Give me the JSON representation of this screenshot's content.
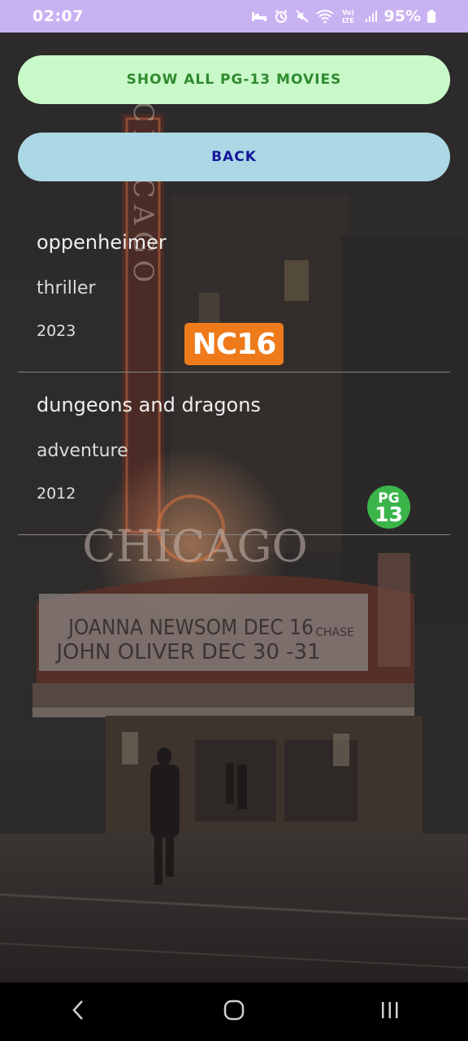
{
  "status_bar": {
    "time": "02:07",
    "battery": "95%",
    "icons": [
      "bed-icon",
      "alarm-icon",
      "mute-icon",
      "wifi-icon",
      "volte-icon",
      "signal-icon",
      "battery-icon"
    ],
    "volte_label": "Vo) LTE"
  },
  "buttons": {
    "show_all": "SHOW ALL PG-13 MOVIES",
    "back": "BACK"
  },
  "movies": [
    {
      "title": "oppenheimer",
      "genre": "thriller",
      "year": "2023",
      "rating": "NC16"
    },
    {
      "title": "dungeons and dragons",
      "genre": "adventure",
      "year": "2012",
      "rating_top": "PG",
      "rating_bottom": "13"
    }
  ],
  "background_image": {
    "marquee_line1": "JOANNA NEWSOM DEC 16",
    "marquee_line2": "JOHN OLIVER DEC 30 -31",
    "sign_text": "CHICAGO",
    "vertical_sign": "CHICAGO",
    "sponsor": "CHASE"
  },
  "nav_bar": {
    "icons": [
      "back-icon",
      "home-icon",
      "recents-icon"
    ]
  },
  "colors": {
    "status_bar": "#c9b2f2",
    "show_all_bg": "#c9f9c9",
    "show_all_text": "#2e8b2e",
    "back_bg": "#acd8e6",
    "back_text": "#16169a",
    "nc16": "#ee7a1b",
    "pg13": "#3bb54a"
  }
}
